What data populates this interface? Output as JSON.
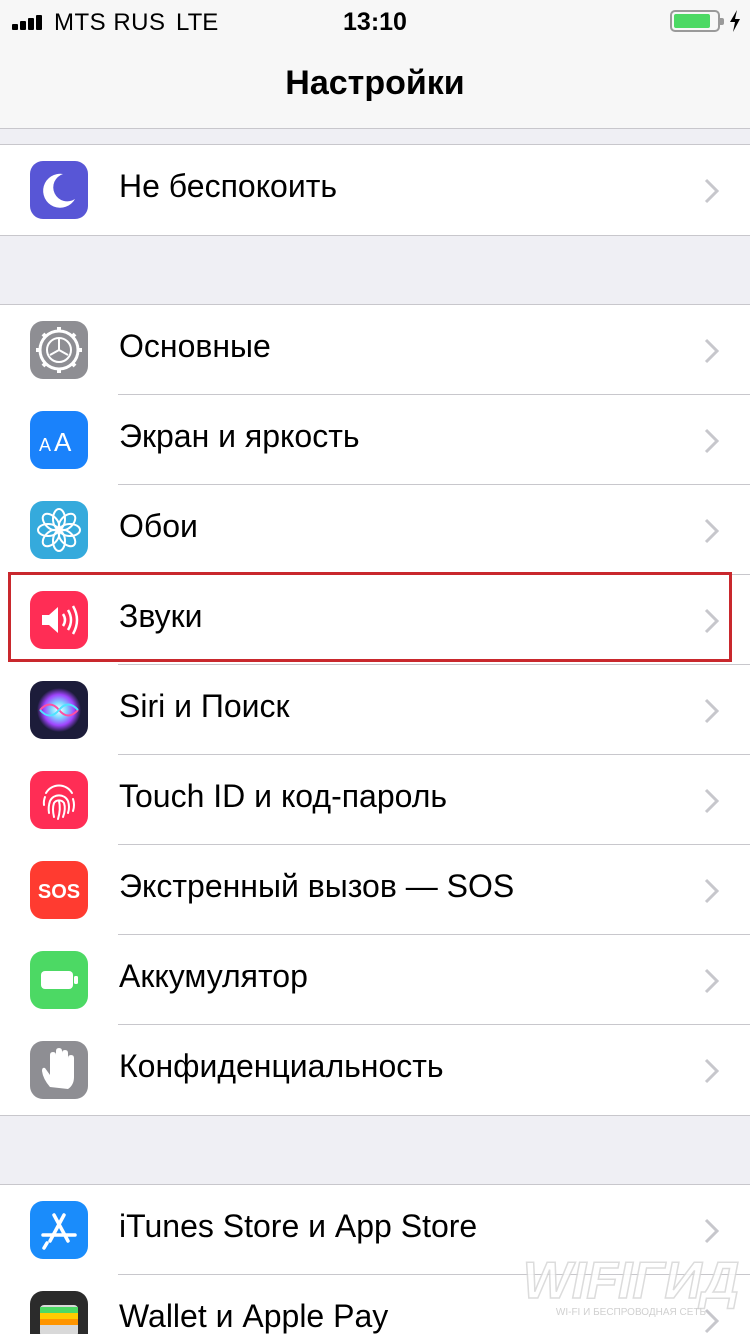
{
  "status_bar": {
    "carrier": "MTS RUS",
    "network": "LTE",
    "time": "13:10",
    "battery_level": 0.85
  },
  "nav": {
    "title": "Настройки"
  },
  "groups": [
    {
      "items": [
        {
          "label": "Не беспокоить",
          "icon": "moon-icon",
          "color": "#5856d6"
        }
      ]
    },
    {
      "items": [
        {
          "label": "Основные",
          "icon": "gear-icon",
          "color": "#8e8e93"
        },
        {
          "label": "Экран и яркость",
          "icon": "text-size-icon",
          "color": "#1a82fb"
        },
        {
          "label": "Обои",
          "icon": "flower-icon",
          "color": "#35aadc"
        },
        {
          "label": "Звуки",
          "icon": "speaker-icon",
          "color": "#ff2d55",
          "highlighted": true
        },
        {
          "label": "Siri и Поиск",
          "icon": "siri-icon",
          "color": "#1c1c3a"
        },
        {
          "label": "Touch ID и код-пароль",
          "icon": "fingerprint-icon",
          "color": "#ff2d55"
        },
        {
          "label": "Экстренный вызов — SOS",
          "icon": "sos-icon",
          "icon_text": "SOS",
          "color": "#ff3b30"
        },
        {
          "label": "Аккумулятор",
          "icon": "battery-icon",
          "color": "#4cd964"
        },
        {
          "label": "Конфиденциальность",
          "icon": "hand-icon",
          "color": "#8e8e93"
        }
      ]
    },
    {
      "items": [
        {
          "label": "iTunes Store и App Store",
          "icon": "app-store-icon",
          "color": "#1a8cfb"
        },
        {
          "label": "Wallet и Apple Pay",
          "icon": "wallet-icon",
          "color": "#2b2b2b"
        }
      ]
    }
  ],
  "watermark": {
    "title": "WIFIГИД",
    "subtitle": "WI-FI И БЕСПРОВОДНАЯ СЕТЬ"
  },
  "colors": {
    "highlight": "#c9282d",
    "separator": "#c8c7cc",
    "background": "#efeff4"
  }
}
